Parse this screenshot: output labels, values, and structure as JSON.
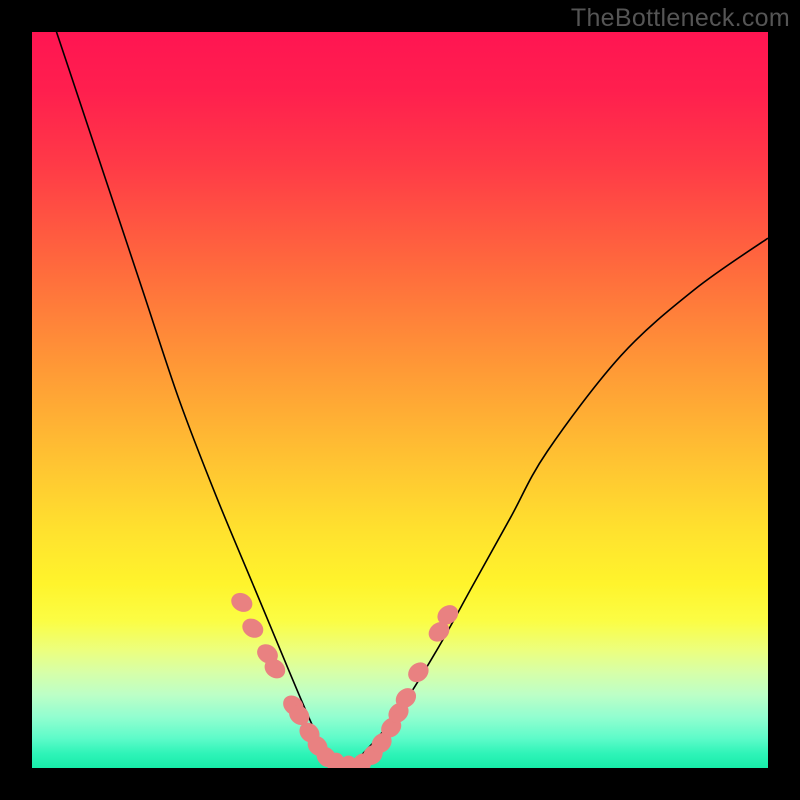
{
  "watermark": "TheBottleneck.com",
  "colors": {
    "curve": "#000000",
    "marker_fill": "#e98181",
    "marker_stroke": "#e98181",
    "background": "#000000"
  },
  "chart_data": {
    "type": "line",
    "title": "",
    "xlabel": "",
    "ylabel": "",
    "xlim": [
      0,
      1
    ],
    "ylim": [
      0,
      1
    ],
    "series": [
      {
        "name": "bottleneck-curve",
        "x": [
          0.0,
          0.05,
          0.1,
          0.15,
          0.2,
          0.25,
          0.3,
          0.35,
          0.38,
          0.4,
          0.42,
          0.45,
          0.5,
          0.55,
          0.6,
          0.65,
          0.7,
          0.8,
          0.9,
          1.0
        ],
        "y": [
          1.1,
          0.95,
          0.8,
          0.65,
          0.5,
          0.37,
          0.25,
          0.13,
          0.06,
          0.02,
          0.0,
          0.02,
          0.08,
          0.16,
          0.25,
          0.34,
          0.43,
          0.56,
          0.65,
          0.72
        ]
      }
    ],
    "markers": {
      "name": "highlight-points",
      "points": [
        {
          "x": 0.285,
          "y": 0.225
        },
        {
          "x": 0.3,
          "y": 0.19
        },
        {
          "x": 0.32,
          "y": 0.155
        },
        {
          "x": 0.33,
          "y": 0.135
        },
        {
          "x": 0.355,
          "y": 0.085
        },
        {
          "x": 0.363,
          "y": 0.072
        },
        {
          "x": 0.377,
          "y": 0.048
        },
        {
          "x": 0.388,
          "y": 0.03
        },
        {
          "x": 0.4,
          "y": 0.015
        },
        {
          "x": 0.413,
          "y": 0.006
        },
        {
          "x": 0.43,
          "y": 0.002
        },
        {
          "x": 0.448,
          "y": 0.006
        },
        {
          "x": 0.463,
          "y": 0.018
        },
        {
          "x": 0.475,
          "y": 0.034
        },
        {
          "x": 0.488,
          "y": 0.055
        },
        {
          "x": 0.498,
          "y": 0.075
        },
        {
          "x": 0.508,
          "y": 0.095
        },
        {
          "x": 0.525,
          "y": 0.13
        },
        {
          "x": 0.553,
          "y": 0.185
        },
        {
          "x": 0.565,
          "y": 0.208
        }
      ]
    }
  }
}
